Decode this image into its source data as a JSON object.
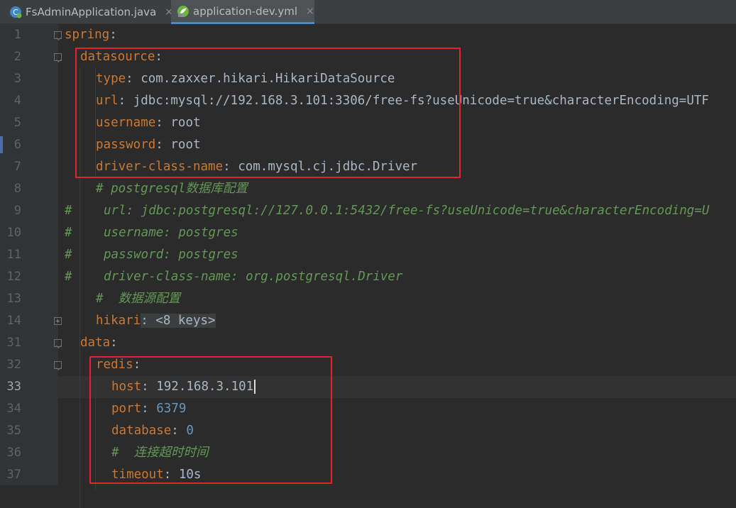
{
  "tabs": [
    {
      "label": "FsAdminApplication.java",
      "icon": "spring-boot-java-class-icon",
      "close": "×",
      "active": false
    },
    {
      "label": "application-dev.yml",
      "icon": "spring-yaml-config-icon",
      "close": "×",
      "active": true
    }
  ],
  "editor": {
    "current_line": "33",
    "lines": [
      {
        "num": "1",
        "parts": [
          {
            "t": "spring",
            "c": "k"
          },
          {
            "t": ":",
            "c": "v"
          }
        ]
      },
      {
        "num": "2",
        "parts": [
          {
            "t": "datasource",
            "c": "k"
          },
          {
            "t": ":",
            "c": "v"
          }
        ]
      },
      {
        "num": "3",
        "parts": [
          {
            "t": "type",
            "c": "k"
          },
          {
            "t": ": ",
            "c": "v"
          },
          {
            "t": "com.zaxxer.hikari.HikariDataSource",
            "c": "v"
          }
        ]
      },
      {
        "num": "4",
        "parts": [
          {
            "t": "url",
            "c": "k"
          },
          {
            "t": ": ",
            "c": "v"
          },
          {
            "t": "jdbc:mysql://192.168.3.101:3306/free-fs?useUnicode=true&characterEncoding=UTF",
            "c": "v"
          }
        ]
      },
      {
        "num": "5",
        "parts": [
          {
            "t": "username",
            "c": "k"
          },
          {
            "t": ": ",
            "c": "v"
          },
          {
            "t": "root",
            "c": "v"
          }
        ]
      },
      {
        "num": "6",
        "parts": [
          {
            "t": "password",
            "c": "k"
          },
          {
            "t": ": ",
            "c": "v"
          },
          {
            "t": "root",
            "c": "v"
          }
        ]
      },
      {
        "num": "7",
        "parts": [
          {
            "t": "driver-class-name",
            "c": "k"
          },
          {
            "t": ": ",
            "c": "v"
          },
          {
            "t": "com.mysql.cj.jdbc.Driver",
            "c": "v"
          }
        ]
      },
      {
        "num": "8",
        "parts": [
          {
            "t": "# postgresql数据库配置",
            "c": "c"
          }
        ]
      },
      {
        "num": "9",
        "parts": [
          {
            "t": "url: jdbc:postgresql://127.0.0.1:5432/free-fs?useUnicode=true&characterEncoding=U",
            "c": "c"
          }
        ],
        "hash": "#"
      },
      {
        "num": "10",
        "parts": [
          {
            "t": "username: postgres",
            "c": "c"
          }
        ],
        "hash": "#"
      },
      {
        "num": "11",
        "parts": [
          {
            "t": "password: postgres",
            "c": "c"
          }
        ],
        "hash": "#"
      },
      {
        "num": "12",
        "parts": [
          {
            "t": "driver-class-name: org.postgresql.Driver",
            "c": "c"
          }
        ],
        "hash": "#"
      },
      {
        "num": "13",
        "parts": [
          {
            "t": "#  数据源配置",
            "c": "c"
          }
        ]
      },
      {
        "num": "14",
        "parts": [
          {
            "t": "hikari",
            "c": "k"
          },
          {
            "t": ": <8 keys>",
            "c": "v"
          }
        ],
        "folded": true
      },
      {
        "num": "31",
        "parts": [
          {
            "t": "data",
            "c": "k"
          },
          {
            "t": ":",
            "c": "v"
          }
        ]
      },
      {
        "num": "32",
        "parts": [
          {
            "t": "redis",
            "c": "k"
          },
          {
            "t": ":",
            "c": "v"
          }
        ]
      },
      {
        "num": "33",
        "parts": [
          {
            "t": "host",
            "c": "k"
          },
          {
            "t": ": ",
            "c": "v"
          },
          {
            "t": "192.168.3.101",
            "c": "v"
          }
        ],
        "cursor": true
      },
      {
        "num": "34",
        "parts": [
          {
            "t": "port",
            "c": "k"
          },
          {
            "t": ": ",
            "c": "v"
          },
          {
            "t": "6379",
            "c": "n"
          }
        ]
      },
      {
        "num": "35",
        "parts": [
          {
            "t": "database",
            "c": "k"
          },
          {
            "t": ": ",
            "c": "v"
          },
          {
            "t": "0",
            "c": "n"
          }
        ]
      },
      {
        "num": "36",
        "parts": [
          {
            "t": "#  连接超时时间",
            "c": "c"
          }
        ]
      },
      {
        "num": "37",
        "parts": [
          {
            "t": "timeout",
            "c": "k"
          },
          {
            "t": ": ",
            "c": "v"
          },
          {
            "t": "10s",
            "c": "v"
          }
        ]
      }
    ]
  },
  "colors": {
    "key": "#cc7832",
    "comment": "#629755",
    "number": "#6897bb",
    "text": "#a9b7c6",
    "highlight_box": "#e0242b",
    "active_tab_underline": "#4a88c7"
  }
}
